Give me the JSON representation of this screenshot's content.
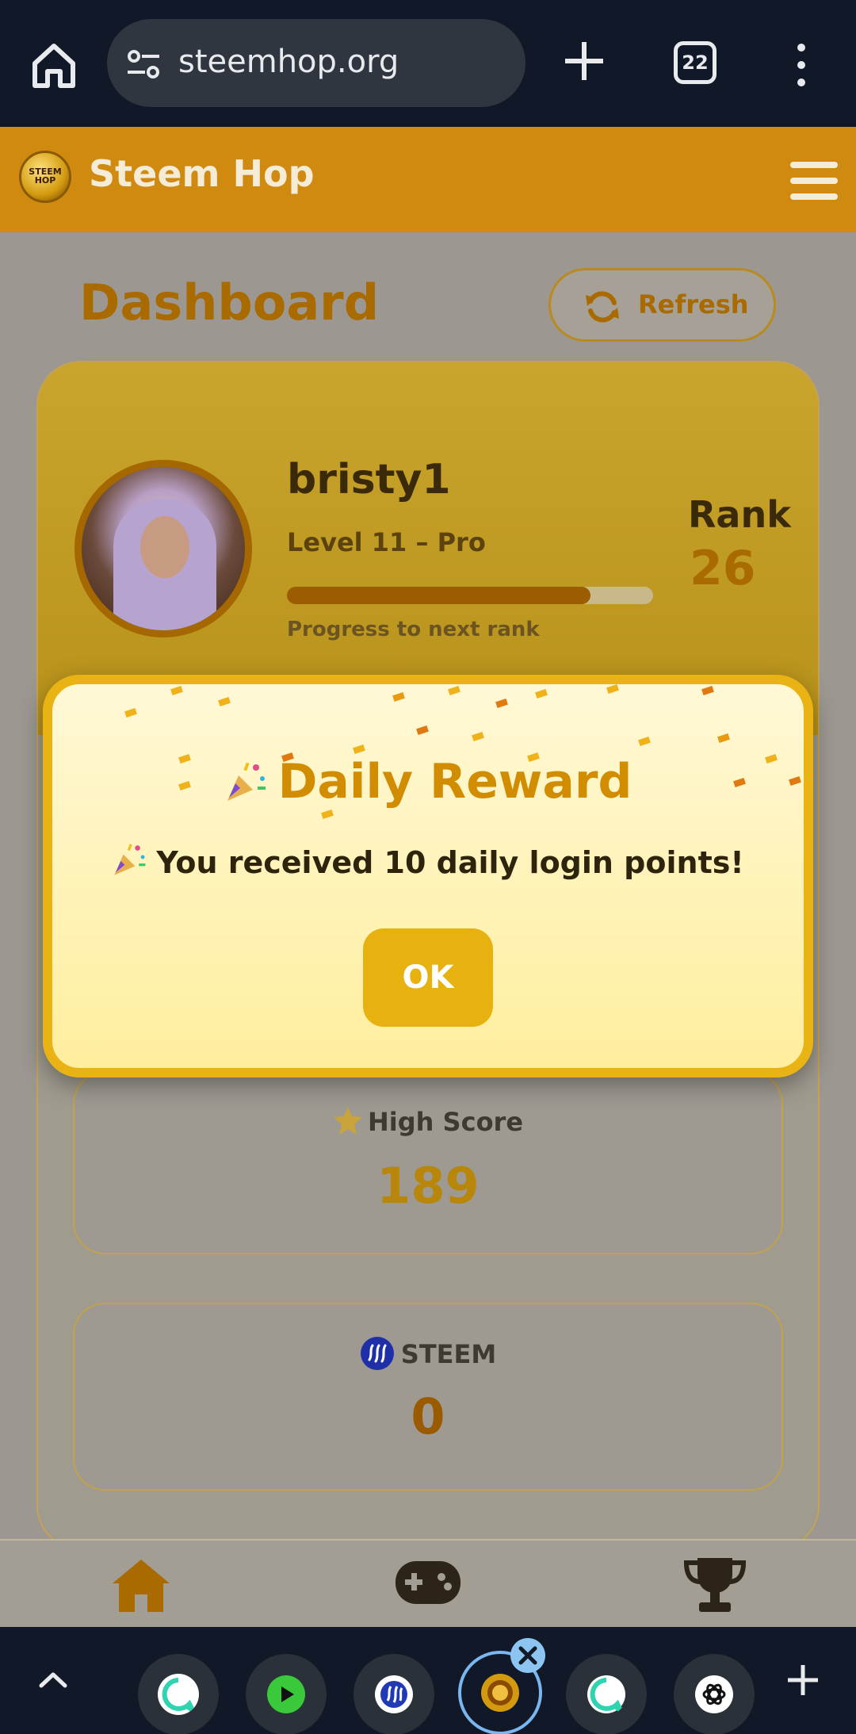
{
  "browser": {
    "url": "steemhop.org",
    "tab_count": "22"
  },
  "app": {
    "title": "Steem Hop",
    "logo_text_line1": "STEEM",
    "logo_text_line2": "HOP",
    "accent_color": "#d08a0f"
  },
  "dashboard": {
    "title": "Dashboard",
    "refresh_label": "Refresh"
  },
  "profile": {
    "username": "bristy1",
    "level": "Level 11 – Pro",
    "progress_fraction": 0.83,
    "progress_label": "Progress to next rank",
    "rank_label": "Rank",
    "rank_value": "26"
  },
  "stats": [
    {
      "icon": "star-icon",
      "label": "High Score",
      "value": "189",
      "value_color": "#b8860b"
    },
    {
      "icon": "steem-icon",
      "label": "STEEM",
      "value": "0",
      "value_color": "#9a5a00"
    }
  ],
  "dialog": {
    "title": "Daily Reward",
    "message": "You received 10 daily login points!",
    "ok_label": "OK"
  },
  "bottom_nav": [
    {
      "icon": "home-icon",
      "label": "Home"
    },
    {
      "icon": "gamepad-icon",
      "label": "Game"
    },
    {
      "icon": "trophy-icon",
      "label": "Leaderboard"
    }
  ],
  "taskbar": {
    "apps": [
      {
        "icon": "chat-bubble-icon",
        "color": "#2ed3b0"
      },
      {
        "icon": "play-app-icon",
        "color": "#3ac93a"
      },
      {
        "icon": "steem-app-icon",
        "color": "#1f3ab4"
      },
      {
        "icon": "steem-hop-app-icon",
        "color": "#d39a10"
      },
      {
        "icon": "chat-bubble-icon",
        "color": "#2ed3b0"
      },
      {
        "icon": "chatgpt-icon",
        "color": "#ffffff"
      }
    ]
  }
}
